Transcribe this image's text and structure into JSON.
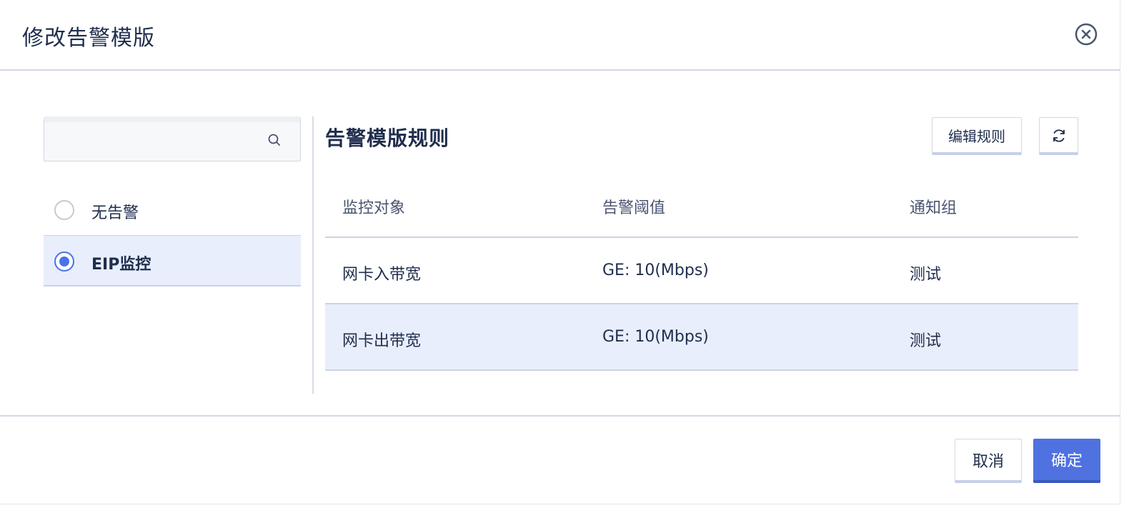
{
  "dialog": {
    "title": "修改告警模版"
  },
  "search": {
    "placeholder": "",
    "value": ""
  },
  "templates": [
    {
      "label": "无告警",
      "selected": false
    },
    {
      "label": "EIP监控",
      "selected": true
    }
  ],
  "rules": {
    "title": "告警模版规则",
    "edit_label": "编辑规则",
    "columns": [
      "监控对象",
      "告警阈值",
      "通知组"
    ],
    "rows": [
      [
        "网卡入带宽",
        "GE: 10(Mbps)",
        "测试"
      ],
      [
        "网卡出带宽",
        "GE: 10(Mbps)",
        "测试"
      ]
    ]
  },
  "footer": {
    "cancel_label": "取消",
    "ok_label": "确定"
  },
  "colors": {
    "accent": "#4f72e0",
    "selected_bg": "#e8eefb",
    "text": "#1f2d4d"
  }
}
